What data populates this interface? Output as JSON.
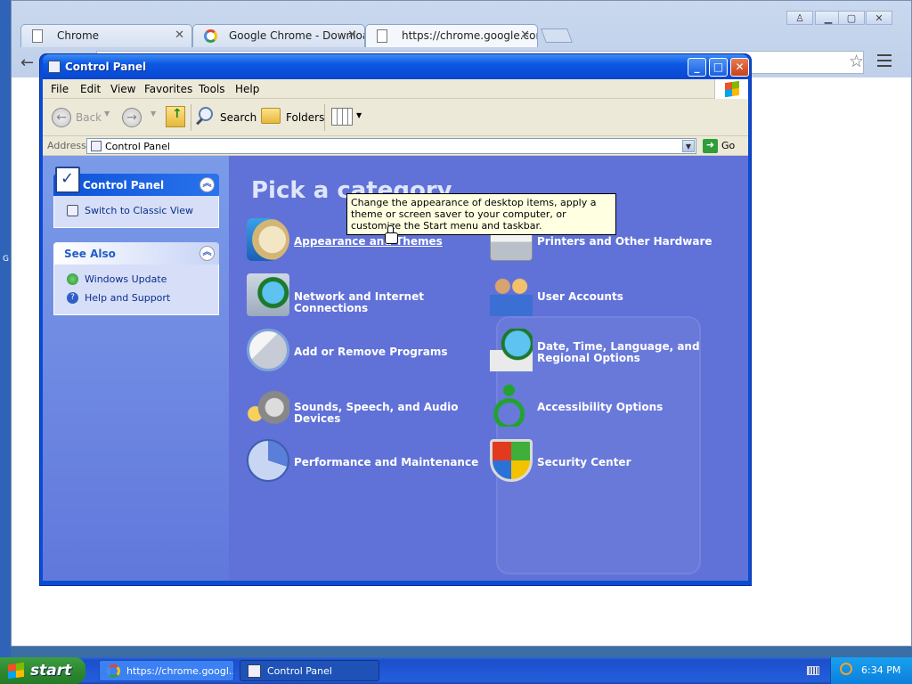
{
  "chrome": {
    "tabs": [
      {
        "title": "Chrome"
      },
      {
        "title": "Google Chrome - Download t"
      },
      {
        "title": "https://chrome.google.com/’"
      }
    ]
  },
  "cp": {
    "title": "Control Panel",
    "menu": [
      "File",
      "Edit",
      "View",
      "Favorites",
      "Tools",
      "Help"
    ],
    "toolbar": {
      "back": "Back",
      "search": "Search",
      "folders": "Folders"
    },
    "address": {
      "label": "Address",
      "value": "Control Panel",
      "go": "Go"
    },
    "left": {
      "cp_header": "Control Panel",
      "switch_view": "Switch to Classic View",
      "see_also_header": "See Also",
      "see_also_items": [
        "Windows Update",
        "Help and Support"
      ]
    },
    "main": {
      "heading": "Pick a category",
      "categories": [
        "Appearance and Themes",
        "Printers and Other Hardware",
        "Network and Internet Connections",
        "User Accounts",
        "Add or Remove Programs",
        "Date, Time, Language, and Regional Options",
        "Sounds, Speech, and Audio Devices",
        "Accessibility Options",
        "Performance and Maintenance",
        "Security Center"
      ],
      "tooltip": "Change the appearance of desktop items, apply a theme or screen saver to your computer, or customize the Start menu and taskbar."
    }
  },
  "taskbar": {
    "start": "start",
    "items": [
      "https://chrome.googl...",
      "Control Panel"
    ],
    "clock": "6:34 PM"
  }
}
